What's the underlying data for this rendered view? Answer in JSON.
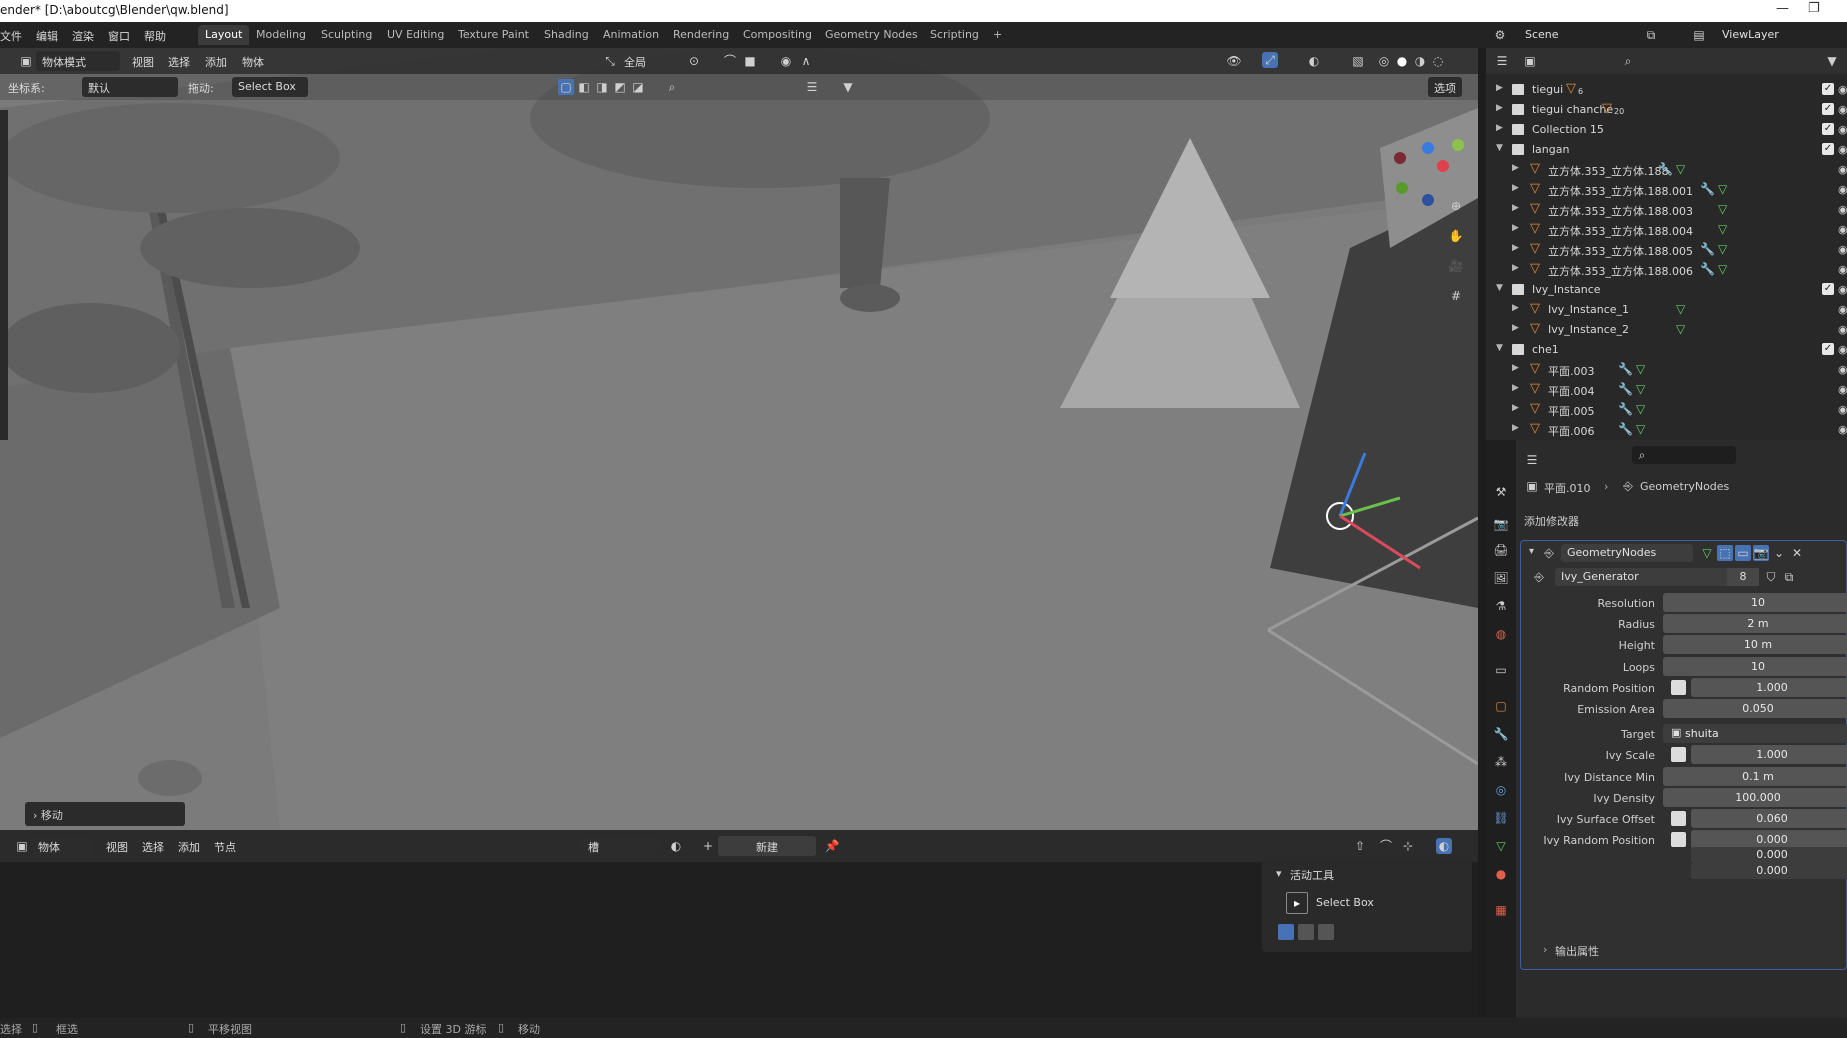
{
  "window": {
    "title": "ender* [D:\\aboutcg\\Blender\\qw.blend]"
  },
  "menubar": {
    "items": [
      "文件",
      "编辑",
      "渲染",
      "窗口",
      "帮助"
    ]
  },
  "workspaces": {
    "tabs": [
      {
        "label": "Layout",
        "active": true
      },
      {
        "label": "Modeling",
        "active": false
      },
      {
        "label": "Sculpting",
        "active": false
      },
      {
        "label": "UV Editing",
        "active": false
      },
      {
        "label": "Texture Paint",
        "active": false
      },
      {
        "label": "Shading",
        "active": false
      },
      {
        "label": "Animation",
        "active": false
      },
      {
        "label": "Rendering",
        "active": false
      },
      {
        "label": "Compositing",
        "active": false
      },
      {
        "label": "Geometry Nodes",
        "active": false
      },
      {
        "label": "Scripting",
        "active": false
      }
    ],
    "add_label": "+"
  },
  "scene_selector": {
    "label": "Scene"
  },
  "viewlayer_selector": {
    "label": "ViewLayer"
  },
  "viewport_header": {
    "mode": "物体模式",
    "menus": [
      "视图",
      "选择",
      "添加",
      "物体"
    ],
    "transform_orientation": "全局",
    "options_label": "选项"
  },
  "tool_settings": {
    "coord_label": "坐标系:",
    "coord_value": "默认",
    "drag_label": "拖动:",
    "drag_value": "Select Box"
  },
  "last_operator": {
    "label": "移动"
  },
  "bottom_editor": {
    "mode": "物体",
    "menus": [
      "视图",
      "选择",
      "添加",
      "节点"
    ],
    "slot_label": "槽",
    "new_label": "新建"
  },
  "active_tool_panel": {
    "header": "活动工具",
    "tool_name": "Select Box"
  },
  "statusbar": {
    "items": [
      "选择",
      "框选",
      "平移视图",
      "设置 3D 游标",
      "移动"
    ]
  },
  "outliner": {
    "rows": [
      {
        "name": "tiegui",
        "type": "collection",
        "depth": 0,
        "expanded": false,
        "count": "6"
      },
      {
        "name": "tiegui chanche",
        "type": "collection",
        "depth": 0,
        "expanded": false,
        "count": "20"
      },
      {
        "name": "Collection 15",
        "type": "collection",
        "depth": 0,
        "expanded": false
      },
      {
        "name": "langan",
        "type": "collection",
        "depth": 0,
        "expanded": true
      },
      {
        "name": "立方体.353_立方体.188",
        "type": "mesh",
        "depth": 1,
        "modifier": true
      },
      {
        "name": "立方体.353_立方体.188.001",
        "type": "mesh",
        "depth": 1,
        "modifier": true
      },
      {
        "name": "立方体.353_立方体.188.003",
        "type": "mesh",
        "depth": 1,
        "modifier": false
      },
      {
        "name": "立方体.353_立方体.188.004",
        "type": "mesh",
        "depth": 1,
        "modifier": false
      },
      {
        "name": "立方体.353_立方体.188.005",
        "type": "mesh",
        "depth": 1,
        "modifier": true
      },
      {
        "name": "立方体.353_立方体.188.006",
        "type": "mesh",
        "depth": 1,
        "modifier": true
      },
      {
        "name": "Ivy_Instance",
        "type": "collection",
        "depth": 0,
        "expanded": true
      },
      {
        "name": "Ivy_Instance_1",
        "type": "mesh",
        "depth": 1,
        "modifier": false
      },
      {
        "name": "Ivy_Instance_2",
        "type": "mesh",
        "depth": 1,
        "modifier": false
      },
      {
        "name": "che1",
        "type": "collection",
        "depth": 0,
        "expanded": true
      },
      {
        "name": "平面.003",
        "type": "mesh",
        "depth": 1,
        "modifier": true
      },
      {
        "name": "平面.004",
        "type": "mesh",
        "depth": 1,
        "modifier": true
      },
      {
        "name": "平面.005",
        "type": "mesh",
        "depth": 1,
        "modifier": true
      },
      {
        "name": "平面.006",
        "type": "mesh",
        "depth": 1,
        "modifier": true
      }
    ]
  },
  "properties": {
    "breadcrumb": {
      "object": "平面.010",
      "modifier": "GeometryNodes"
    },
    "add_modifier_label": "添加修改器",
    "modifier": {
      "name": "GeometryNodes",
      "node_group": "Ivy_Generator",
      "users": "8",
      "inputs": [
        {
          "label": "Resolution",
          "value": "10",
          "socket": false
        },
        {
          "label": "Radius",
          "value": "2 m",
          "socket": false
        },
        {
          "label": "Height",
          "value": "10 m",
          "socket": false
        },
        {
          "label": "Loops",
          "value": "10",
          "socket": false
        },
        {
          "label": "Random Position",
          "value": "1.000",
          "socket": true
        },
        {
          "label": "Emission Area",
          "value": "0.050",
          "socket": false
        },
        {
          "label": "Target",
          "value": "shuita",
          "socket": false,
          "object": true
        },
        {
          "label": "Ivy Scale",
          "value": "1.000",
          "socket": true
        },
        {
          "label": "Ivy Distance Min",
          "value": "0.1 m",
          "socket": false
        },
        {
          "label": "Ivy Density",
          "value": "100.000",
          "socket": false
        },
        {
          "label": "Ivy Surface Offset",
          "value": "0.060",
          "socket": true
        },
        {
          "label": "Ivy Random Position",
          "value": "0.000",
          "socket": true
        }
      ],
      "vector_extra": [
        "0.000",
        "0.000"
      ],
      "output_label": "输出属性"
    }
  },
  "colors": {
    "accent": "#4772b3",
    "mesh_icon": "#e08a3a",
    "modifier_icon": "#6aa0e0",
    "data_icon": "#5fcf5f"
  }
}
